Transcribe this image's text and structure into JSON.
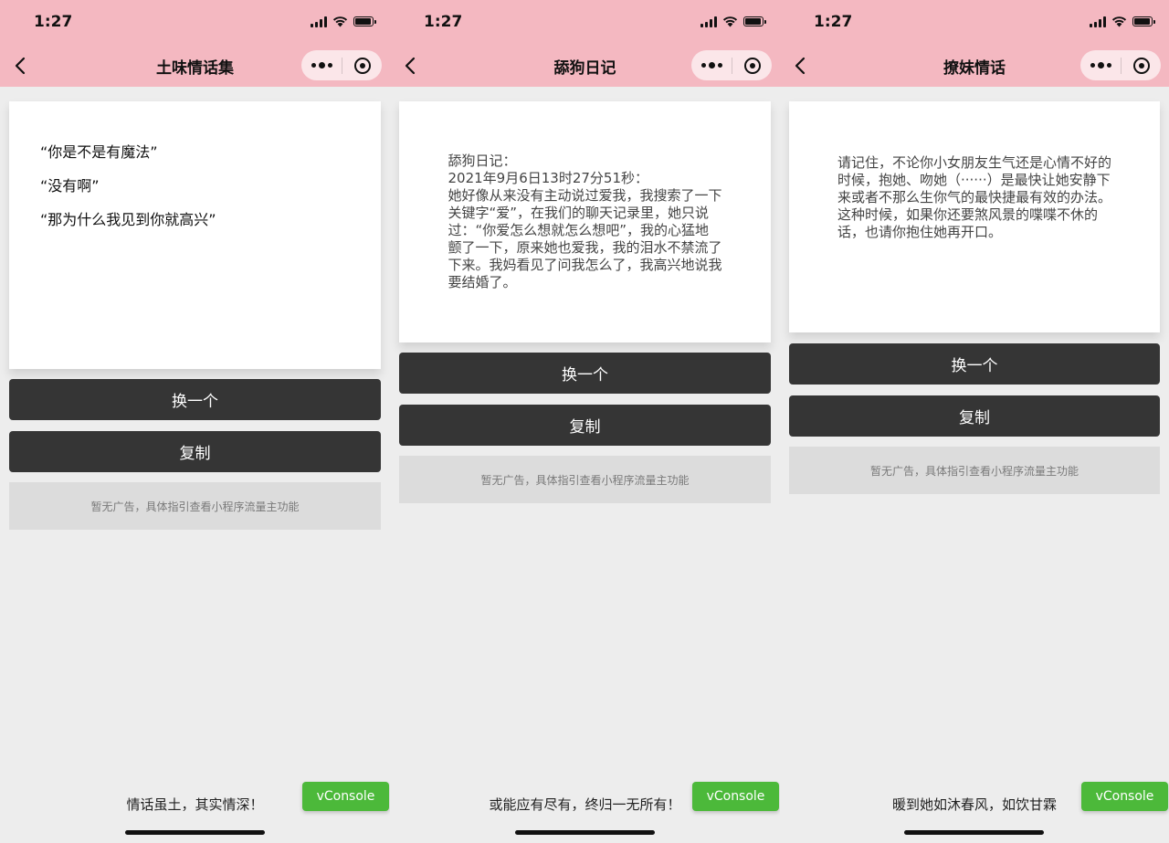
{
  "screens": [
    {
      "status": {
        "time": "1:27"
      },
      "nav": {
        "title": "土味情话集"
      },
      "content": {
        "lines": [
          "“你是不是有魔法”",
          "“没有啊”",
          "“那为什么我见到你就高兴”"
        ]
      },
      "buttons": {
        "change_label": "换一个",
        "copy_label": "复制"
      },
      "ad_text": "暂无广告，具体指引查看小程序流量主功能",
      "slogan": "情话虽土，其实情深！",
      "vconsole_label": "vConsole"
    },
    {
      "status": {
        "time": "1:27"
      },
      "nav": {
        "title": "舔狗日记"
      },
      "content": {
        "text": "舔狗日记：\n2021年9月6日13时27分51秒：\n她好像从来没有主动说过爱我，我搜索了一下关键字“爱”，在我们的聊天记录里，她只说过：“你爱怎么想就怎么想吧”，我的心猛地颤了一下，原来她也爱我，我的泪水不禁流了下来。我妈看见了问我怎么了，我高兴地说我要结婚了。"
      },
      "buttons": {
        "change_label": "换一个",
        "copy_label": "复制"
      },
      "ad_text": "暂无广告，具体指引查看小程序流量主功能",
      "slogan": "或能应有尽有，终归一无所有！",
      "vconsole_label": "vConsole"
    },
    {
      "status": {
        "time": "1:27"
      },
      "nav": {
        "title": "撩妹情话"
      },
      "content": {
        "text": "请记住，不论你小女朋友生气还是心情不好的时候，抱她、吻她（······）是最快让她安静下来或者不那么生你气的最快捷最有效的办法。这种时候，如果你还要煞风景的喋喋不休的话，也请你抱住她再开口。"
      },
      "buttons": {
        "change_label": "换一个",
        "copy_label": "复制"
      },
      "ad_text": "暂无广告，具体指引查看小程序流量主功能",
      "slogan": "暖到她如沐春风，如饮甘霖",
      "vconsole_label": "vConsole"
    }
  ],
  "colors": {
    "header_bg": "#f4b8c1",
    "button_bg": "#353535",
    "ad_bg": "#dcdcdc",
    "vconsole_bg": "#4cb93a",
    "page_bg": "#ededed"
  },
  "icons": {
    "back": "chevron-left-icon",
    "more": "more-dots-icon",
    "close": "target-circle-icon",
    "signal": "cellular-signal-icon",
    "wifi": "wifi-icon",
    "battery": "battery-icon"
  }
}
